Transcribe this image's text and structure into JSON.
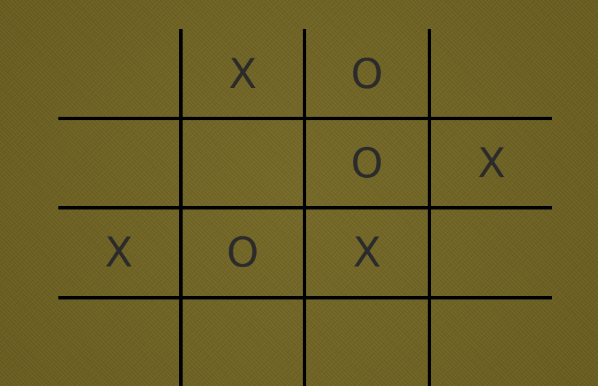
{
  "board": {
    "rows": [
      [
        "",
        "X",
        "O",
        ""
      ],
      [
        "",
        "",
        "O",
        "X"
      ],
      [
        "X",
        "O",
        "X",
        ""
      ],
      [
        "",
        "",
        "",
        ""
      ]
    ]
  },
  "colors": {
    "background": "#6e6223",
    "grid_lines": "#000000",
    "marks": "#2b2b2b"
  }
}
